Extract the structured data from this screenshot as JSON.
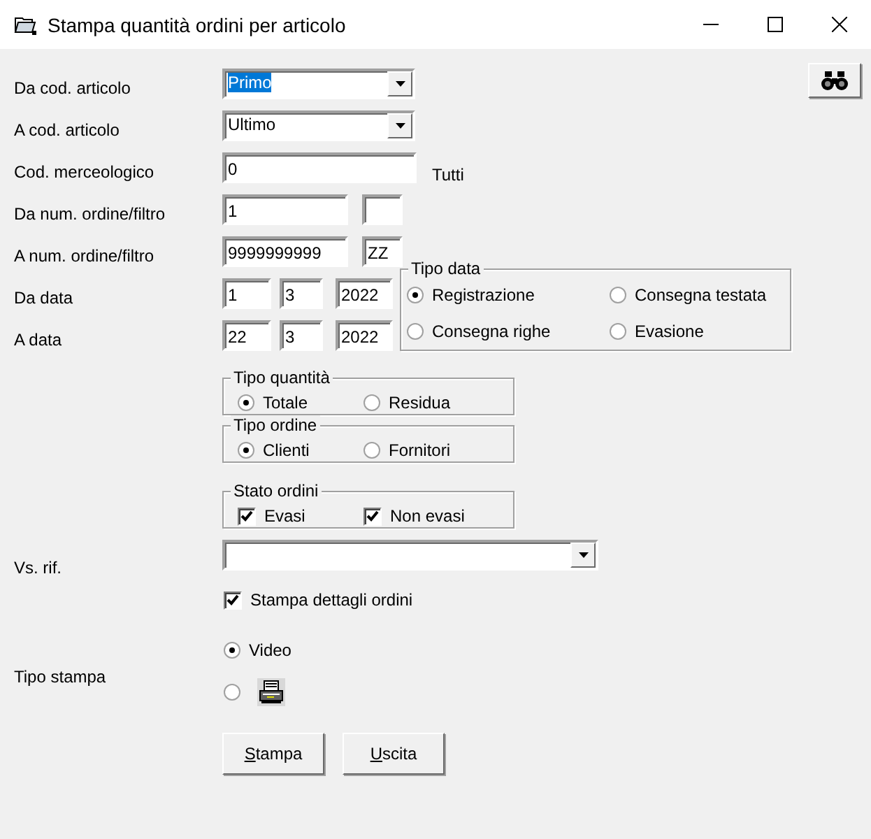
{
  "window": {
    "title": "Stampa quantità ordini per articolo"
  },
  "rows": [
    {
      "kind": "combo",
      "label": "Da cod. articolo",
      "value": "Primo",
      "highlighted": true
    },
    {
      "kind": "combo",
      "label": "A cod. articolo",
      "value": "Ultimo",
      "highlighted": false
    },
    {
      "kind": "text_note",
      "label": "Cod. merceologico",
      "value": "0",
      "note": "Tutti"
    },
    {
      "kind": "pair",
      "label": "Da num. ordine/filtro",
      "value": "1"
    },
    {
      "kind": "pair",
      "label": "A num. ordine/filtro",
      "value": "9999999999",
      "filter": "ZZ"
    },
    {
      "kind": "date",
      "label": "Da data",
      "day": "1",
      "month": "3",
      "year": "2022"
    },
    {
      "kind": "date",
      "label": "A data",
      "day": "22",
      "month": "3",
      "year": "2022"
    }
  ],
  "tipo_data": {
    "title": "Tipo data",
    "options": [
      {
        "label": "Registrazione",
        "selected": true
      },
      {
        "label": "Consegna testata",
        "selected": false
      },
      {
        "label": "Consegna righe",
        "selected": false
      },
      {
        "label": "Evasione",
        "selected": false
      }
    ]
  },
  "groups": [
    {
      "kind": "radio",
      "title": "Tipo quantità",
      "options": [
        {
          "label": "Totale",
          "selected": true
        },
        {
          "label": "Residua",
          "selected": false
        }
      ]
    },
    {
      "kind": "radio",
      "title": "Tipo ordine",
      "options": [
        {
          "label": "Clienti",
          "selected": true
        },
        {
          "label": "Fornitori",
          "selected": false
        }
      ]
    },
    {
      "kind": "checkbox",
      "title": "Stato ordini",
      "options": [
        {
          "label": "Evasi",
          "checked": true
        },
        {
          "label": "Non evasi",
          "checked": true
        }
      ]
    }
  ],
  "vs_rif": {
    "label": "Vs. rif."
  },
  "details": {
    "label": "Stampa dettagli ordini",
    "checked": true
  },
  "tipo_stampa": {
    "label": "Tipo stampa",
    "options": [
      {
        "kind": "text",
        "label": "Video",
        "selected": true
      },
      {
        "kind": "printer",
        "selected": false
      }
    ]
  },
  "buttons": [
    "Stampa",
    "Uscita"
  ]
}
